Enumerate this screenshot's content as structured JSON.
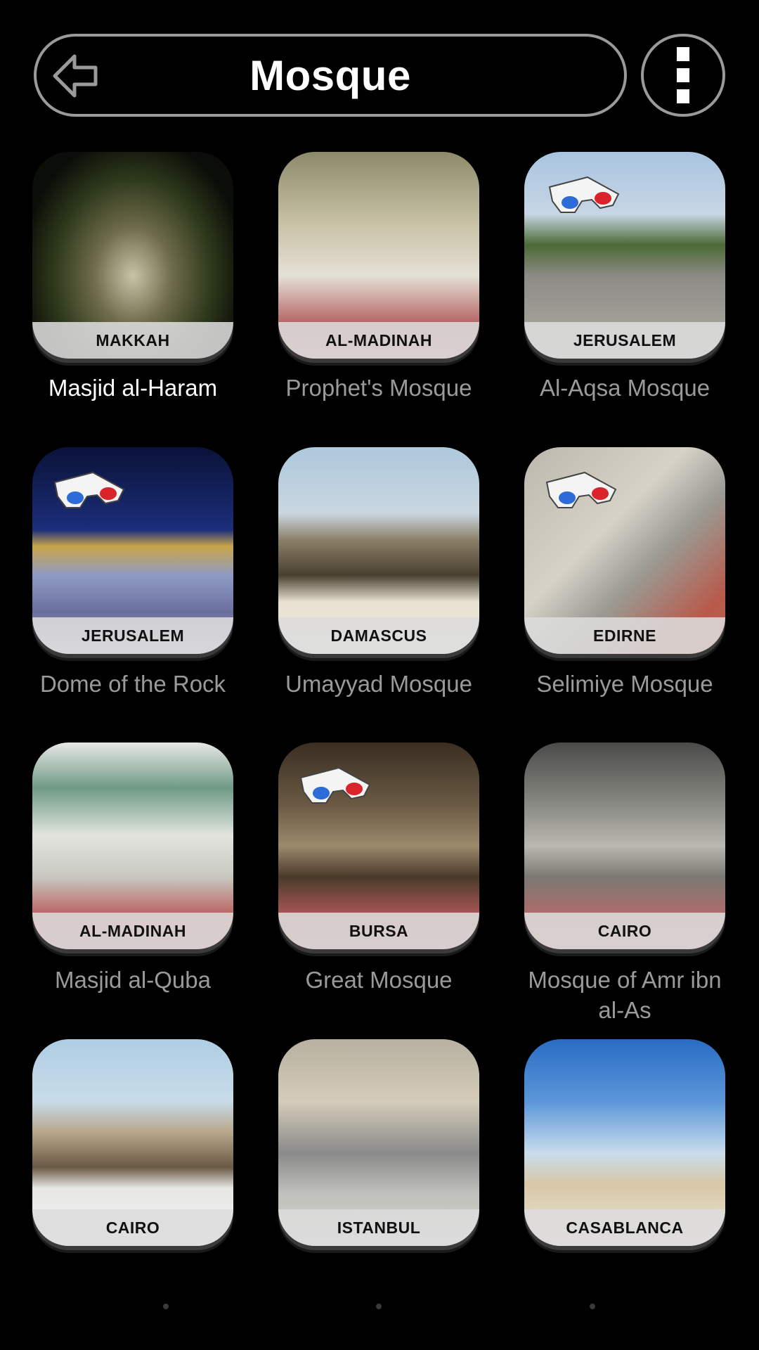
{
  "header": {
    "title": "Mosque",
    "back_icon": "back-arrow-icon",
    "menu_icon": "more-vertical-icon"
  },
  "items": [
    {
      "city": "MAKKAH",
      "name": "Masjid al-Haram",
      "glasses_3d": false,
      "selected": true
    },
    {
      "city": "AL-MADINAH",
      "name": "Prophet's Mosque",
      "glasses_3d": false,
      "selected": false
    },
    {
      "city": "JERUSALEM",
      "name": "Al-Aqsa Mosque",
      "glasses_3d": true,
      "selected": false
    },
    {
      "city": "JERUSALEM",
      "name": "Dome of the Rock",
      "glasses_3d": true,
      "selected": false
    },
    {
      "city": "DAMASCUS",
      "name": "Umayyad Mosque",
      "glasses_3d": false,
      "selected": false
    },
    {
      "city": "EDIRNE",
      "name": "Selimiye Mosque",
      "glasses_3d": true,
      "selected": false
    },
    {
      "city": "AL-MADINAH",
      "name": "Masjid al-Quba",
      "glasses_3d": false,
      "selected": false
    },
    {
      "city": "BURSA",
      "name": "Great Mosque",
      "glasses_3d": true,
      "selected": false
    },
    {
      "city": "CAIRO",
      "name": "Mosque of Amr ibn al-As",
      "glasses_3d": false,
      "selected": false
    },
    {
      "city": "CAIRO",
      "name": "",
      "glasses_3d": false,
      "selected": false
    },
    {
      "city": "ISTANBUL",
      "name": "",
      "glasses_3d": false,
      "selected": false
    },
    {
      "city": "CASABLANCA",
      "name": "",
      "glasses_3d": false,
      "selected": false
    }
  ],
  "colors": {
    "background": "#000000",
    "outline": "#9a9a9a",
    "label_active": "#ffffff",
    "label_inactive": "#9a9a9a",
    "caption_bar": "#dcdcdc"
  }
}
